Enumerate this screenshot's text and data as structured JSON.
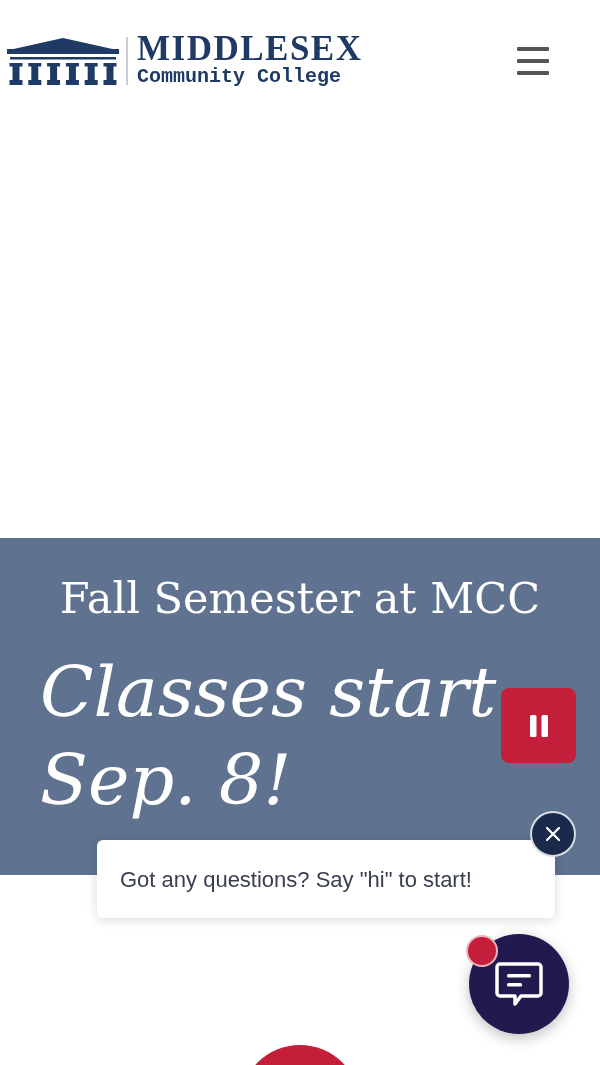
{
  "header": {
    "logo": {
      "title": "MIDDLESEX",
      "subtitle": "Community College"
    }
  },
  "banner": {
    "title": "Fall Semester at MCC",
    "headline": "Classes start Sep. 8!",
    "slideshow": {
      "playing": true
    }
  },
  "chat": {
    "greeting": "Got any questions? Say \"hi\" to start!",
    "unread": true
  }
}
